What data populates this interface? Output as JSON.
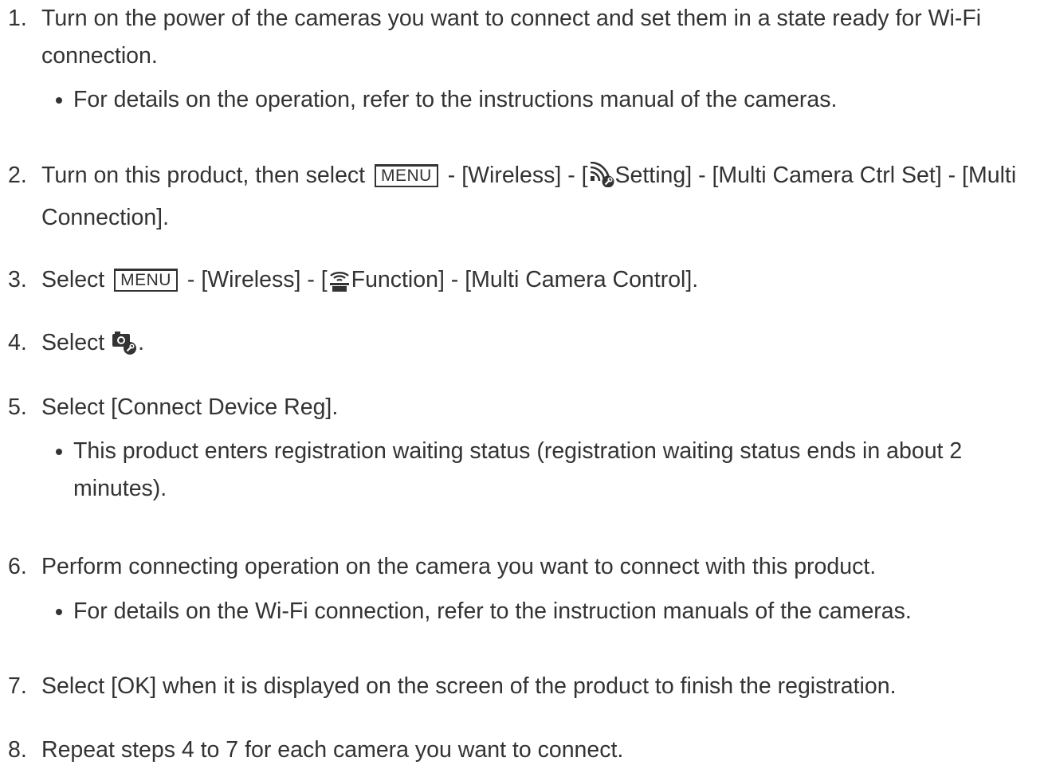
{
  "steps": [
    {
      "num": "1.",
      "text": "Turn on the power of the cameras you want to connect and set them in a state ready for Wi-Fi connection.",
      "bullet": "For details on the operation, refer to the instructions manual of the cameras."
    },
    {
      "num": "2.",
      "pre": "Turn on this product, then select",
      "menu": "MENU",
      "mid": "- [Wireless] - [",
      "icon": "wifi-setting-icon",
      "post": "Setting] - [Multi Camera Ctrl Set] - [Multi Connection]."
    },
    {
      "num": "3.",
      "pre": "Select",
      "menu": "MENU",
      "mid": "- [Wireless] - [",
      "icon": "wifi-function-icon",
      "post": "Function] - [Multi Camera Control]."
    },
    {
      "num": "4.",
      "pre": "Select",
      "icon": "camera-setting-icon",
      "post": "."
    },
    {
      "num": "5.",
      "text": "Select [Connect Device Reg].",
      "bullet": "This product enters registration waiting status (registration waiting status ends in about 2 minutes)."
    },
    {
      "num": "6.",
      "text": "Perform connecting operation on the camera you want to connect with this product.",
      "bullet": "For details on the Wi-Fi connection, refer to the instruction manuals of the cameras."
    },
    {
      "num": "7.",
      "text": "Select [OK] when it is displayed on the screen of the product to finish the registration."
    },
    {
      "num": "8.",
      "text": "Repeat steps 4 to 7 for each camera you want to connect."
    }
  ]
}
